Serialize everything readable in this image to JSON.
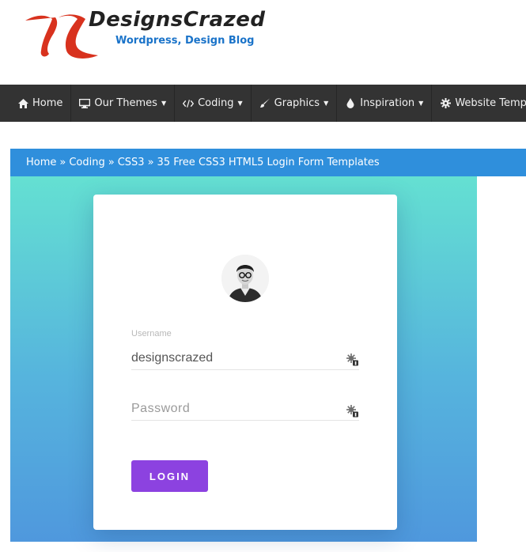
{
  "header": {
    "logo_title": "DesignsCrazed",
    "logo_tagline": "Wordpress, Design Blog",
    "brand_color": "#d8321e"
  },
  "nav": {
    "items": [
      {
        "label": "Home",
        "icon": "home-icon",
        "dropdown": false
      },
      {
        "label": "Our Themes",
        "icon": "monitor-icon",
        "dropdown": true
      },
      {
        "label": "Coding",
        "icon": "code-icon",
        "dropdown": true
      },
      {
        "label": "Graphics",
        "icon": "brush-icon",
        "dropdown": true
      },
      {
        "label": "Inspiration",
        "icon": "droplet-icon",
        "dropdown": true
      },
      {
        "label": "Website Templates",
        "icon": "gear-icon",
        "dropdown": true
      }
    ],
    "caret": "▼"
  },
  "breadcrumb": {
    "items": [
      "Home",
      "Coding",
      "CSS3",
      "35 Free CSS3 HTML5 Login Form Templates"
    ],
    "separator": "»",
    "color": "#2f8fdc"
  },
  "login_form": {
    "username_label": "Username",
    "username_value": "designscrazed",
    "password_placeholder": "Password",
    "login_button": "LOGIN",
    "button_color": "#8c42e0"
  }
}
